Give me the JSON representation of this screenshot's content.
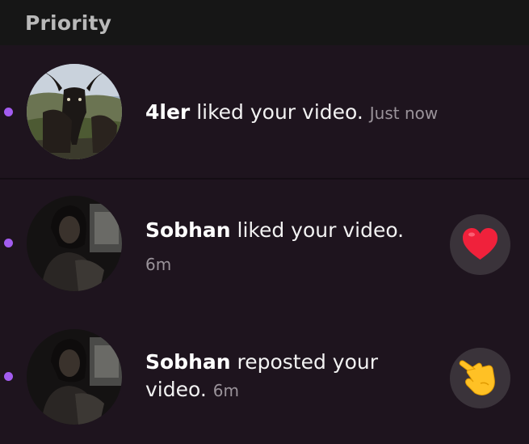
{
  "header": {
    "title": "Priority"
  },
  "notifications": [
    {
      "user": "4ler",
      "action": " liked your video.",
      "time": "Just now",
      "unread": true,
      "avatar": "goat-photo",
      "reaction_icon": null
    },
    {
      "user": "Sobhan",
      "action": " liked your video.",
      "time": "6m",
      "unread": true,
      "avatar": "person-dark-photo",
      "reaction_icon": "heart-icon"
    },
    {
      "user": "Sobhan",
      "action_line1": " reposted your",
      "action_line2": "video.",
      "time": "6m",
      "unread": true,
      "avatar": "person-dark-photo",
      "reaction_icon": "pointing-hand-icon"
    }
  ],
  "colors": {
    "background": "#1e141e",
    "header": "#161616",
    "unread_dot": "#a35cf0",
    "heart": "#f0213b",
    "reaction_bg": "#3a333a"
  }
}
